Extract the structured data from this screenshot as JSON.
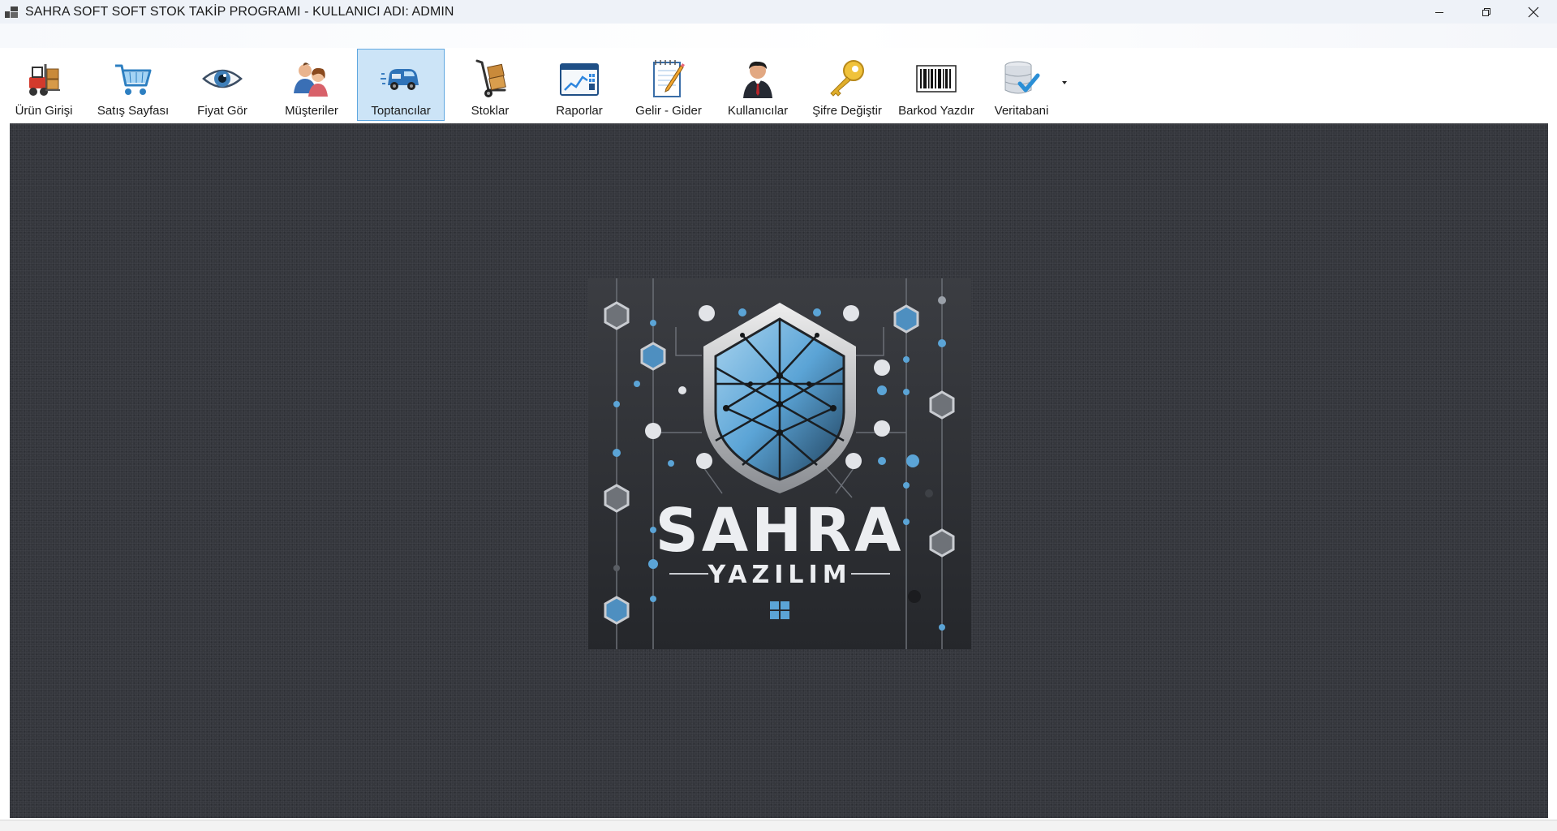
{
  "window": {
    "title": "SAHRA SOFT SOFT STOK TAKİP PROGRAMI - KULLANICI ADI: ADMIN",
    "app_icon": "app-window-icon",
    "controls": [
      "minimize-icon",
      "restore-icon",
      "close-icon"
    ]
  },
  "toolbar": {
    "buttons": [
      {
        "label": "Ürün Girişi",
        "icon": "forklift-icon"
      },
      {
        "label": "Satış Sayfası",
        "icon": "shopping-cart-icon"
      },
      {
        "label": "Fiyat Gör",
        "icon": "eye-icon"
      },
      {
        "label": "Müşteriler",
        "icon": "customers-icon"
      },
      {
        "label": "Toptancılar",
        "icon": "delivery-truck-icon"
      },
      {
        "label": "Stoklar",
        "icon": "hand-truck-icon"
      },
      {
        "label": "Raporlar",
        "icon": "report-chart-icon"
      },
      {
        "label": "Gelir - Gider",
        "icon": "notepad-pencil-icon"
      },
      {
        "label": "Kullanıcılar",
        "icon": "user-icon"
      },
      {
        "label": "Şifre Değiştir",
        "icon": "key-icon"
      },
      {
        "label": "Barkod Yazdır",
        "icon": "barcode-icon"
      },
      {
        "label": "Veritabani",
        "icon": "database-icon"
      }
    ],
    "active": "Toptancılar"
  },
  "logo": {
    "title": "SAHRA",
    "subtitle": "YAZILIM"
  },
  "colors": {
    "titlebar": "#eef2f8",
    "content_bg": "#35373d",
    "active_button": "#cce4f7",
    "active_border": "#5fa7e0",
    "logo_accent": "#5ba4d6"
  }
}
